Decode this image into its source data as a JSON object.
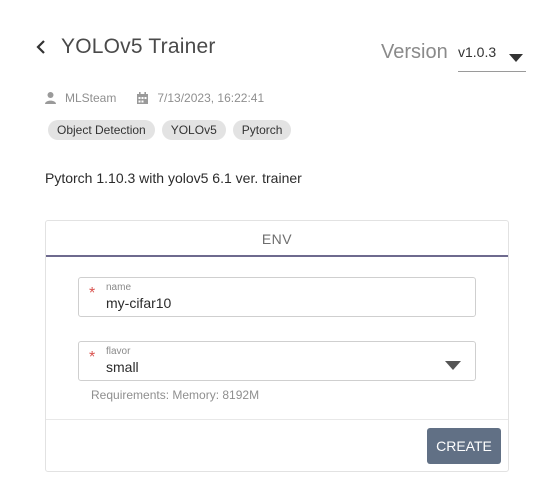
{
  "header": {
    "title": "YOLOv5 Trainer",
    "version_label": "Version",
    "version_value": "v1.0.3"
  },
  "meta": {
    "owner": "MLSteam",
    "date": "7/13/2023, 16:22:41"
  },
  "tags": [
    "Object Detection",
    "YOLOv5",
    "Pytorch"
  ],
  "description": "Pytorch 1.10.3 with yolov5 6.1 ver. trainer",
  "card": {
    "tab_label": "ENV",
    "name_field": {
      "label": "name",
      "value": "my-cifar10",
      "required_mark": "*"
    },
    "flavor_field": {
      "label": "flavor",
      "value": "small",
      "required_mark": "*"
    },
    "requirements": "Requirements: Memory: 8192M",
    "create_label": "CREATE"
  },
  "icons": {
    "back": "chevron-left-icon",
    "version_caret": "caret-down-icon",
    "owner": "user-icon",
    "date": "calendar-icon",
    "flavor_caret": "caret-down-icon"
  },
  "colors": {
    "tab_underline": "#6e6a8e",
    "create_button": "#617085",
    "required": "#d9534f"
  }
}
